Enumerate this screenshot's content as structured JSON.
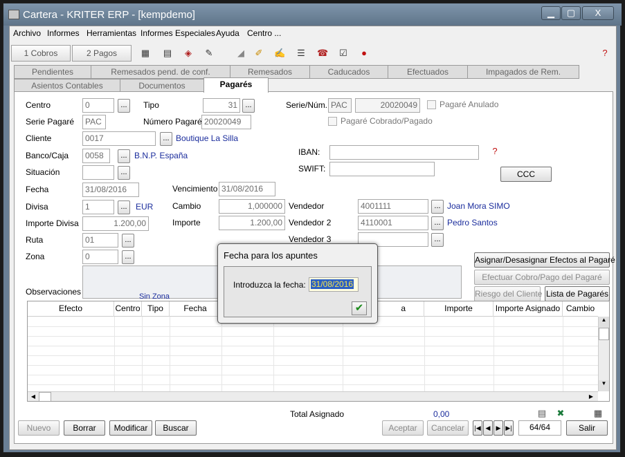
{
  "window": {
    "title": "Cartera - KRITER ERP - [kempdemo]",
    "min": "▁",
    "max": "▢",
    "close": "X"
  },
  "menu": [
    "Archivo",
    "Informes",
    "Herramientas",
    "Informes Especiales",
    "Ayuda",
    "Centro ..."
  ],
  "toolbar": {
    "cobros": "1 Cobros",
    "pagos": "2 Pagos"
  },
  "tabs_row1": [
    "Pendientes",
    "Remesados pend. de conf.",
    "Remesados",
    "Caducados",
    "Efectuados",
    "Impagados de Rem."
  ],
  "tabs_row2": [
    "Asientos Contables",
    "Documentos",
    "Pagarés"
  ],
  "form": {
    "centro_label": "Centro",
    "centro": "0",
    "tipo_label": "Tipo",
    "tipo": "31",
    "serienum_label": "Serie/Núm.",
    "serie": "PAC",
    "num": "20020049",
    "anulado_label": "Pagaré Anulado",
    "seriepagare_label": "Serie Pagaré",
    "seriepagare": "PAC",
    "numeropagare_label": "Número Pagaré",
    "numeropagare": "20020049",
    "cobrado_label": "Pagaré Cobrado/Pagado",
    "cliente_label": "Cliente",
    "cliente": "0017",
    "cliente_name": "Boutique La Silla",
    "banco_label": "Banco/Caja",
    "banco": "0058",
    "banco_name": "B.N.P. España",
    "iban_label": "IBAN:",
    "swift_label": "SWIFT:",
    "ccc_label": "CCC",
    "situacion_label": "Situación",
    "fecha_label": "Fecha",
    "fecha": "31/08/2016",
    "venc_label": "Vencimiento",
    "venc": "31/08/2016",
    "divisa_label": "Divisa",
    "divisa": "1",
    "divisa_name": "EUR",
    "cambio_label": "Cambio",
    "cambio": "1,000000",
    "vendedor_label": "Vendedor",
    "vendedor": "4001111",
    "vendedor_name": "Joan Mora SIMO",
    "impdiv_label": "Importe Divisa",
    "impdiv": "1.200,00",
    "importe_label": "Importe",
    "importe": "1.200,00",
    "vendedor2_label": "Vendedor 2",
    "vendedor2": "4110001",
    "vendedor2_name": "Pedro Santos",
    "ruta_label": "Ruta",
    "ruta": "01",
    "vendedor3_label": "Vendedor 3",
    "zona_label": "Zona",
    "zona": "0",
    "obs_label": "Observaciones",
    "obs_hint": "Sin Zona"
  },
  "actions": {
    "asignar": "Asignar/Desasignar Efectos al Pagaré",
    "efectuar": "Efectuar Cobro/Pago del Pagaré",
    "riesgo": "Riesgo del Cliente",
    "lista": "Lista de Pagarés"
  },
  "grid": {
    "columns": [
      "Efecto",
      "Centro",
      "Tipo",
      "Fecha",
      "",
      "",
      "a",
      "Importe",
      "Importe Asignado",
      "Cambio"
    ]
  },
  "totals": {
    "label": "Total Asignado",
    "value": "0,00"
  },
  "bottom": {
    "nuevo": "Nuevo",
    "borrar": "Borrar",
    "modificar": "Modificar",
    "buscar": "Buscar",
    "aceptar": "Aceptar",
    "cancelar": "Cancelar",
    "record": "64/64",
    "salir": "Salir"
  },
  "dialog": {
    "title": "Fecha para los apuntes",
    "prompt": "Introduzca la fecha:",
    "value": "31/08/2016",
    "ok": "✔"
  }
}
